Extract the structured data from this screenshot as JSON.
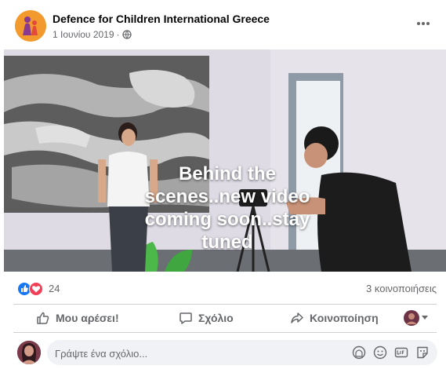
{
  "post": {
    "page_name": "Defence for Children International Greece",
    "date": "1 Ιουνίου 2019",
    "separator": "·",
    "privacy_icon": "globe-icon",
    "more_icon": "more-options-icon"
  },
  "photo": {
    "overlay_text": "Behind the scenes..new video coming soon..stay tuned"
  },
  "reactions": {
    "icons": [
      "like-icon",
      "love-icon"
    ],
    "count": "24",
    "shares": "3 κοινοποιήσεις"
  },
  "actions": {
    "like": "Μου αρέσει!",
    "comment": "Σχόλιο",
    "share": "Κοινοποίηση"
  },
  "comment": {
    "placeholder": "Γράψτε ένα σχόλιο...",
    "tools": [
      "sticker-icon",
      "emoji-icon",
      "gif-icon",
      "sticker-pack-icon"
    ]
  },
  "colors": {
    "like_blue": "#1877f2",
    "love_red": "#f33e58",
    "text_primary": "#050505",
    "text_secondary": "#65676b"
  }
}
